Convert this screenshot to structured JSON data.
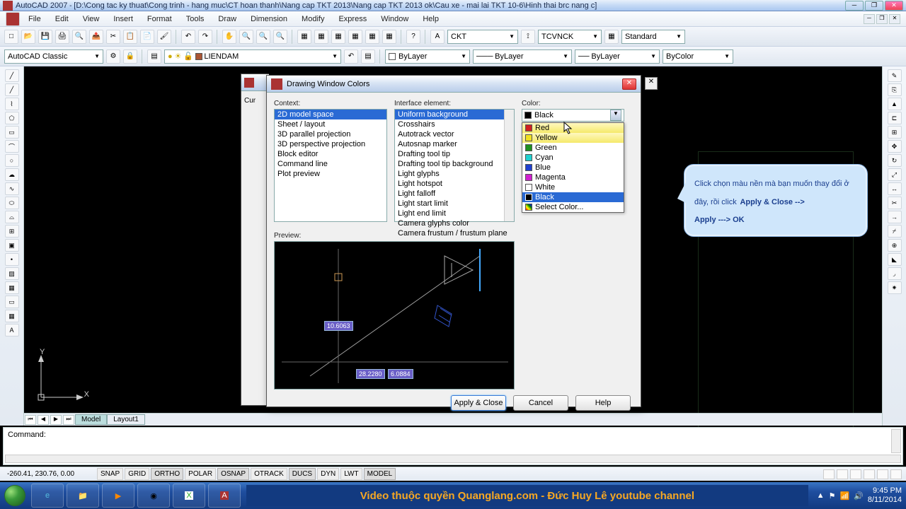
{
  "window": {
    "app": "AutoCAD 2007",
    "path": "[D:\\Cong tac ky thuat\\Cong trinh - hang muc\\CT hoan thanh\\Nang cap TKT 2013\\Nang cap TKT 2013 ok\\Cau xe - mai lai TKT 10-6\\Hinh thai brc nang c]"
  },
  "menu": [
    "File",
    "Edit",
    "View",
    "Insert",
    "Format",
    "Tools",
    "Draw",
    "Dimension",
    "Modify",
    "Express",
    "Window",
    "Help"
  ],
  "toolbar2": {
    "style1": "CKT",
    "style2": "TCVNCK",
    "style3": "Standard"
  },
  "workspace_combo": "AutoCAD Classic",
  "layer_combo": "LIENDAM",
  "props": {
    "color": "ByLayer",
    "ltype": "ByLayer",
    "lweight": "ByLayer",
    "plot": "ByColor"
  },
  "tabs": {
    "model": "Model",
    "layout": "Layout1"
  },
  "command_prompt": "Command:",
  "status": {
    "coords": "-260.41, 230.76, 0.00",
    "buttons": [
      "SNAP",
      "GRID",
      "ORTHO",
      "POLAR",
      "OSNAP",
      "OTRACK",
      "DUCS",
      "DYN",
      "LWT",
      "MODEL"
    ]
  },
  "tray": {
    "time": "9:45 PM",
    "date": "8/11/2014"
  },
  "banner": "Video thuộc quyền Quanglang.com - Đức Huy Lê youtube channel",
  "dialog": {
    "title": "Drawing Window Colors",
    "labels": {
      "context": "Context:",
      "element": "Interface element:",
      "color": "Color:",
      "preview": "Preview:"
    },
    "context_items": [
      "2D model space",
      "Sheet / layout",
      "3D parallel projection",
      "3D perspective projection",
      "Block editor",
      "Command line",
      "Plot preview"
    ],
    "element_items": [
      "Uniform background",
      "Crosshairs",
      "Autotrack vector",
      "Autosnap marker",
      "Drafting tool tip",
      "Drafting tool tip background",
      "Light glyphs",
      "Light hotspot",
      "Light falloff",
      "Light start limit",
      "Light end limit",
      "Camera glyphs color",
      "Camera frustum / frustum plane"
    ],
    "current_color": "Black",
    "colors": [
      {
        "name": "Red",
        "hex": "#d02020"
      },
      {
        "name": "Yellow",
        "hex": "#f0e020"
      },
      {
        "name": "Green",
        "hex": "#209020"
      },
      {
        "name": "Cyan",
        "hex": "#20d0d0"
      },
      {
        "name": "Blue",
        "hex": "#2040d0"
      },
      {
        "name": "Magenta",
        "hex": "#d020d0"
      },
      {
        "name": "White",
        "hex": "#ffffff"
      },
      {
        "name": "Black",
        "hex": "#000000"
      }
    ],
    "select_color": "Select Color...",
    "preview_tags": {
      "dim1": "10.6063",
      "dim2": "28.2280",
      "dim3": "6.0884"
    },
    "buttons": {
      "apply": "Apply & Close",
      "cancel": "Cancel",
      "help": "Help"
    },
    "behind_label": "Cur"
  },
  "callout": {
    "line1": "Click chọn màu nền mà bạn muốn thay đổi ở đây, rồi click",
    "line2": "Apply & Close -->",
    "line3": "Apply ---> OK"
  },
  "ucs": {
    "y": "Y",
    "x": "X"
  }
}
